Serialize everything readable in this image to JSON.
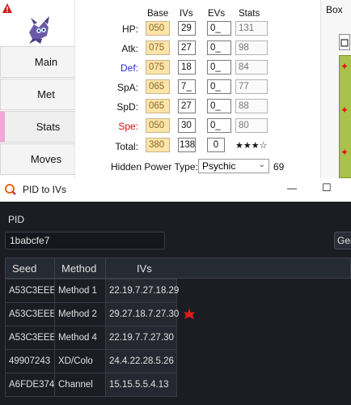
{
  "pkhex": {
    "tabs": [
      {
        "label": "Main"
      },
      {
        "label": "Met"
      },
      {
        "label": "Stats"
      },
      {
        "label": "Moves"
      }
    ],
    "box_label": "Box",
    "headers": {
      "base": "Base",
      "ivs": "IVs",
      "evs": "EVs",
      "stats": "Stats"
    },
    "stat_rows": [
      {
        "label": "HP:",
        "base": "050",
        "iv": "29",
        "ev": "0_",
        "stat": "131",
        "color": "#111111"
      },
      {
        "label": "Atk:",
        "base": "075",
        "iv": "27",
        "ev": "0_",
        "stat": "98",
        "color": "#111111"
      },
      {
        "label": "Def:",
        "base": "075",
        "iv": "18",
        "ev": "0_",
        "stat": "84",
        "color": "#2b2bd6"
      },
      {
        "label": "SpA:",
        "base": "065",
        "iv": "7_",
        "ev": "0_",
        "stat": "77",
        "color": "#111111"
      },
      {
        "label": "SpD:",
        "base": "065",
        "iv": "27",
        "ev": "0_",
        "stat": "88",
        "color": "#111111"
      },
      {
        "label": "Spe:",
        "base": "050",
        "iv": "30",
        "ev": "0_",
        "stat": "80",
        "color": "#d01010"
      }
    ],
    "total": {
      "label": "Total:",
      "base": "380",
      "iv": "138",
      "ev": "0",
      "stars": "★★★☆"
    },
    "hidden_power": {
      "label": "Hidden Power Type:",
      "type": "Psychic",
      "power": "69"
    }
  },
  "window": {
    "title": "PID to IVs",
    "minimize_glyph": "—",
    "maximize_glyph": "☐"
  },
  "form": {
    "pid_label": "PID",
    "pid_value": "1babcfe7",
    "generate_label": "Gen"
  },
  "table": {
    "columns": [
      "Seed",
      "Method",
      "IVs"
    ],
    "rows": [
      {
        "seed": "A53C3EEE",
        "method": "Method 1",
        "ivs": "22.19.7.27.18.29",
        "marked": false
      },
      {
        "seed": "A53C3EEE",
        "method": "Method 2",
        "ivs": "29.27.18.7.27.30",
        "marked": true
      },
      {
        "seed": "A53C3EEE",
        "method": "Method 4",
        "ivs": "22.19.7.7.27.30",
        "marked": false
      },
      {
        "seed": "49907243",
        "method": "XD/Colo",
        "ivs": "24.4.22.28.5.26",
        "marked": false
      },
      {
        "seed": "A6FDE374",
        "method": "Channel",
        "ivs": "15.15.5.5.4.13",
        "marked": false
      }
    ]
  },
  "colors": {
    "accent_pink": "#f2a7d6",
    "marker_red": "#e11b1b"
  }
}
